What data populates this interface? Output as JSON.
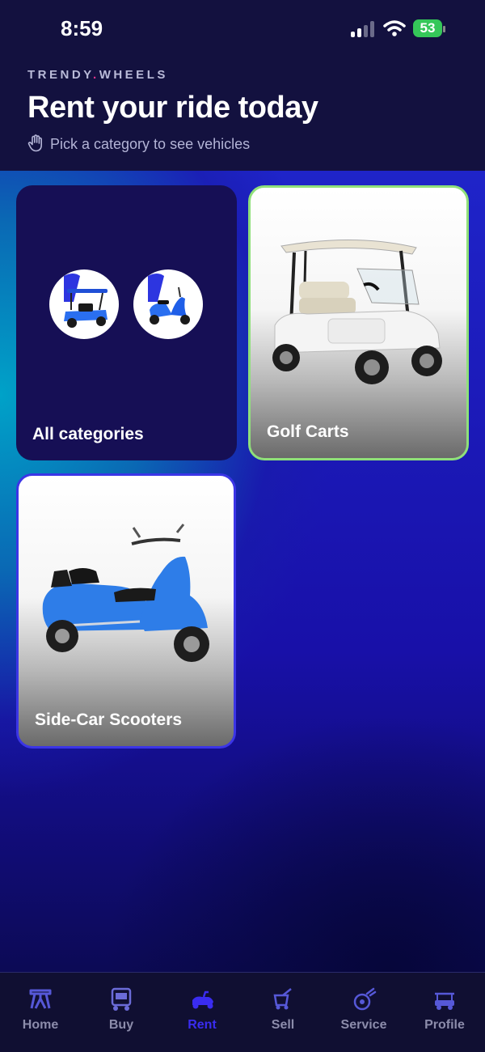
{
  "status": {
    "time": "8:59",
    "battery": "53"
  },
  "header": {
    "brand_left": "TRENDY",
    "brand_dot": ".",
    "brand_right": "WHEELS",
    "title": "Rent your ride today",
    "subtitle": "Pick a category to see vehicles"
  },
  "categories": [
    {
      "label": "All categories",
      "selected": false
    },
    {
      "label": "Golf Carts",
      "selected": true
    },
    {
      "label": "Side-Car Scooters",
      "selected": false
    }
  ],
  "tabs": [
    {
      "label": "Home",
      "icon": "home-icon"
    },
    {
      "label": "Buy",
      "icon": "buy-icon"
    },
    {
      "label": "Rent",
      "icon": "rent-icon",
      "active": true
    },
    {
      "label": "Sell",
      "icon": "sell-icon"
    },
    {
      "label": "Service",
      "icon": "service-icon"
    },
    {
      "label": "Profile",
      "icon": "profile-icon"
    }
  ],
  "colors": {
    "accent": "#3a2cf0",
    "selected_border": "#8fe07a",
    "brand_dot": "#e6358a",
    "battery": "#35c759"
  }
}
